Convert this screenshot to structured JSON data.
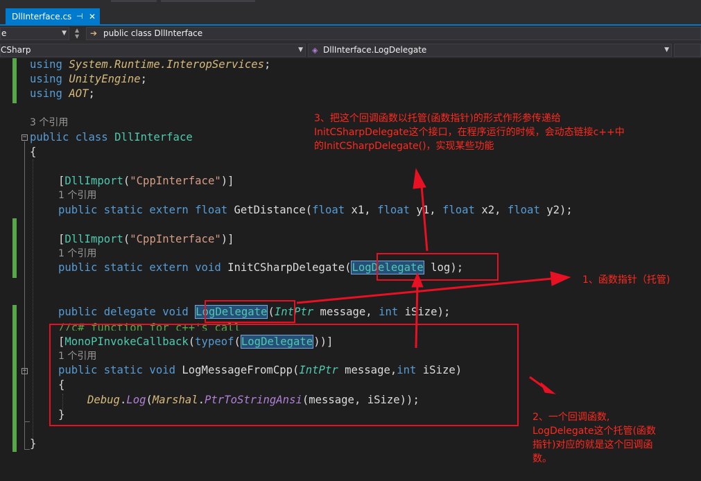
{
  "tabs": [
    {
      "label": "DllInterface.cs",
      "pin_icon": "pin-icon",
      "close_icon": "close-icon"
    }
  ],
  "navbar": {
    "left_value": "e",
    "scope_value": "public class DllInterface"
  },
  "member_bar": {
    "project_value": "CSharp",
    "member_value": "DllInterface.LogDelegate"
  },
  "code": {
    "line1": {
      "kw": "using",
      "ns": "System.Runtime.InteropServices",
      "end": ";"
    },
    "line2": {
      "kw": "using",
      "ns": "UnityEngine",
      "end": ";"
    },
    "line3": {
      "kw": "using",
      "ns": "AOT",
      "end": ";"
    },
    "ref_class": "3 个引用",
    "class_decl": {
      "kw": "public class",
      "name": "DllInterface"
    },
    "brace_open": "{",
    "attr1": {
      "open": "[",
      "name": "DllImport",
      "arg": "\"CppInterface\"",
      "close": ")]"
    },
    "ref_get": "1 个引用",
    "get_distance": {
      "kw": "public static extern float",
      "rest1": " GetDistance(",
      "p1": "float",
      "p1n": " x1, ",
      "p2": "float",
      "p2n": " y1, ",
      "p3": "float",
      "p3n": " x2, ",
      "p4": "float",
      "p4n": " y2);"
    },
    "attr2": {
      "open": "[",
      "name": "DllImport",
      "arg": "\"CppInterface\"",
      "close": ")]"
    },
    "ref_init": "1 个引用",
    "init_delegate": {
      "kw": "public static extern void",
      "name": " InitCSharpDelegate(",
      "type": "LogDelegate",
      "rest": " log);"
    },
    "delegate_decl": {
      "kw": "public delegate void",
      "name": "LogDelegate",
      "open": "(",
      "p1": "IntPtr",
      "p1n": " message, ",
      "p2": "int",
      "p2n": " iSize",
      "close": ");"
    },
    "comment": "//c# function for c++'s call",
    "mono_attr": {
      "open": "[",
      "name": "MonoPInvokeCallback",
      "open2": "(",
      "kw": "typeof",
      "open3": "(",
      "type": "LogDelegate",
      "close": "))]"
    },
    "ref_log": "1 个引用",
    "log_method": {
      "kw": "public static void",
      "name": " LogMessageFromCpp(",
      "p1": "IntPtr",
      "p1n": " message,",
      "p2": "int",
      "p2n": " iSize)"
    },
    "inner_open": "{",
    "debug_line": {
      "debug": "Debug",
      "dot": ".",
      "log": "Log",
      "open": "(",
      "marshal": "Marshal",
      "dot2": ".",
      "fn": "PtrToStringAnsi",
      "args": "(message, iSize));"
    },
    "inner_close": "}",
    "brace_close": "}"
  },
  "annotations": {
    "note3_line1": "3、把这个回调函数以托管(函数指针)的形式作形参传递给",
    "note3_line2": "InitCSharpDelegate这个接口，在程序运行的时候，会动态链接c++中",
    "note3_line3": "的InitCSharpDelegate()，实现某些功能",
    "note1": "1、函数指针（托管)",
    "note2_line1": "2、一个回调函数,",
    "note2_line2": "LogDelegate这个托管(函数",
    "note2_line3": "指针)对应的就是这个回调函",
    "note2_line4": "数。"
  },
  "colors": {
    "accent": "#007acc",
    "annotation_red": "#ff2a1f",
    "keyword": "#569cd6",
    "type": "#4ec9b0",
    "string": "#d69d85",
    "comment": "#57a64a",
    "method_italic": "#d7ba7d"
  }
}
